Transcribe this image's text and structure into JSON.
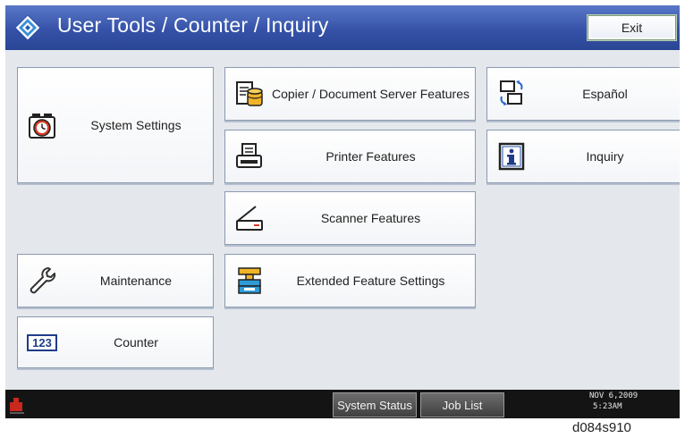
{
  "header": {
    "title": "User Tools / Counter / Inquiry",
    "exit_label": "Exit"
  },
  "tiles": {
    "system_settings": "System Settings",
    "copier": "Copier / Document Server Features",
    "espanol": "Español",
    "printer": "Printer Features",
    "inquiry": "Inquiry",
    "scanner": "Scanner Features",
    "maintenance": "Maintenance",
    "extended": "Extended Feature Settings",
    "counter": "Counter"
  },
  "icons": {
    "title": "user-tools-diamond-icon",
    "system_settings": "alarm-clock-icon",
    "copier": "document-server-icon",
    "espanol": "language-switch-icon",
    "printer": "printer-icon",
    "inquiry": "info-icon",
    "scanner": "scanner-icon",
    "maintenance": "wrench-icon",
    "extended": "extended-features-icon",
    "counter": "counter-123-icon",
    "footer_left": "status-indicator-icon"
  },
  "footer": {
    "system_status": "System Status",
    "job_list": "Job List",
    "date": "NOV   6,2009",
    "time": "5:23AM"
  },
  "caption": "d084s910",
  "colors": {
    "titlebar": "#3552a8",
    "background": "#e4e8ed",
    "footer": "#141414",
    "tile_border": "#8c99b0"
  }
}
